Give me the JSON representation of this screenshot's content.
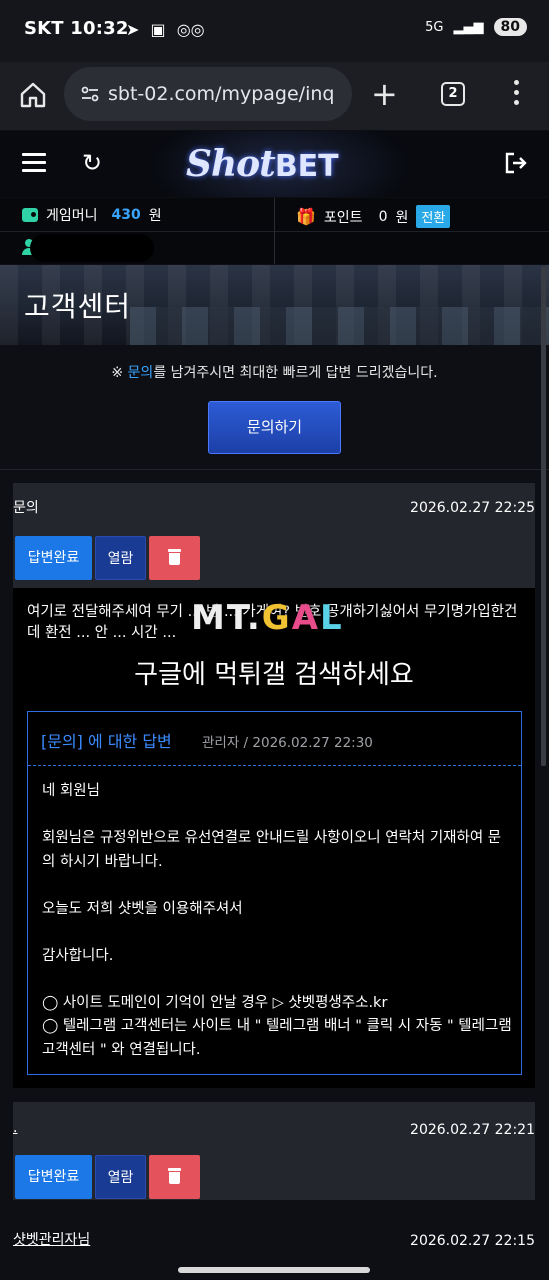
{
  "status_bar": {
    "carrier": "SKT",
    "time": "10:32",
    "network": "5G",
    "battery": "80"
  },
  "browser": {
    "url": "sbt-02.com/mypage/inq",
    "tab_count": "2"
  },
  "site": {
    "logo_shot": "Shot",
    "logo_bet": "BET"
  },
  "account": {
    "game_money_label": "게임머니",
    "game_money_value": "430",
    "game_money_unit": "원",
    "points_label": "포인트",
    "points_value": "0",
    "points_unit": "원",
    "convert_label": "전환"
  },
  "banner": {
    "title": "고객센터"
  },
  "notice": {
    "prefix": "※ ",
    "highlight": "문의",
    "suffix": "를 남겨주시면 최대한 빠르게 답변 드리겠습니다."
  },
  "inquiry_button": "문의하기",
  "posts": [
    {
      "title": "문의",
      "date": "2026.02.27 22:25",
      "status_label": "답변완료",
      "open_label": "열람",
      "question": "여기로 전달해주세여 무기 ... 번 ... 가게여? 번호 공개하기싫어서 무기명가입한건데 환전 ... 안 ... 시간 ...",
      "watermark": {
        "m": "M",
        "t": "T",
        "g": "G",
        "a": "A",
        "l": "L",
        "dot": "."
      },
      "search_message": "구글에 먹튀갤 검색하세요",
      "answer": {
        "title": "[문의] 에 대한 답변",
        "meta": "관리자 / 2026.02.27 22:30",
        "lines": [
          "네 회원님",
          "회원님은 규정위반으로 유선연결로 안내드릴 사항이오니 연락처 기재하여 문의 하시기 바랍니다.",
          "오늘도 저희 샷벳을 이용해주셔서",
          "감사합니다.",
          "◯ 사이트 도메인이 기억이 안날 경우 ▷ 샷벳평생주소.kr",
          "◯ 텔레그램 고객센터는 사이트 내 \" 텔레그램 배너 \" 클릭 시 자동 \" 텔레그램 고객센터 \" 와 연결됩니다."
        ]
      }
    },
    {
      "title": ".",
      "date": "2026.02.27 22:21",
      "status_label": "답변완료",
      "open_label": "열람"
    },
    {
      "title": "샷벳관리자님",
      "date": "2026.02.27 22:15"
    }
  ]
}
